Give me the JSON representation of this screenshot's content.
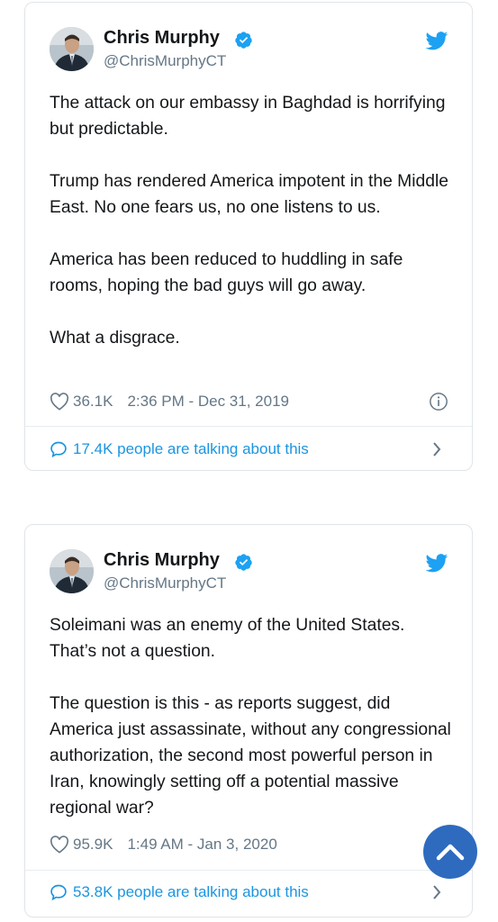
{
  "tweets": [
    {
      "author": "Chris Murphy",
      "handle": "@ChrisMurphyCT",
      "paragraphs": [
        "The attack on our embassy in Baghdad is horrifying but predictable.",
        "Trump has rendered America impotent in the Middle East. No one fears us, no one listens to us.",
        "America has been reduced to huddling in safe rooms, hoping the bad guys will go away.",
        "What a disgrace."
      ],
      "likes": "36.1K",
      "timestamp": "2:36 PM - Dec 31, 2019",
      "talking": "17.4K people are talking about this"
    },
    {
      "author": "Chris Murphy",
      "handle": "@ChrisMurphyCT",
      "paragraphs": [
        "Soleimani was an enemy of the United States. That’s not a question.",
        "The question is this - as reports suggest, did America just assassinate, without any congressional authorization, the second most powerful person in Iran, knowingly setting off a potential massive regional war?"
      ],
      "likes": "95.9K",
      "timestamp": "1:49 AM - Jan 3, 2020",
      "talking": "53.8K people are talking about this"
    }
  ],
  "icons": {
    "verified": "verified-badge-icon",
    "twitter": "twitter-bird-icon",
    "heart": "heart-icon",
    "info": "info-icon",
    "reply": "speech-bubble-icon",
    "chevron": "chevron-right-icon",
    "scroll_top": "chevron-up-icon"
  },
  "colors": {
    "brand_blue": "#1da1f2",
    "link_blue": "#1b95e0",
    "muted": "#657786",
    "text": "#14171a",
    "fab": "#2e6bbf"
  }
}
